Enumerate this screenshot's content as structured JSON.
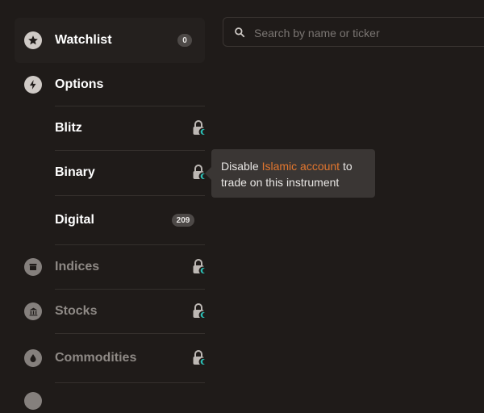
{
  "search": {
    "placeholder": "Search by name or ticker"
  },
  "sidebar": {
    "watchlist": {
      "label": "Watchlist",
      "count": "0"
    },
    "options": {
      "label": "Options"
    },
    "items": [
      {
        "label": "Blitz"
      },
      {
        "label": "Binary"
      },
      {
        "label": "Digital",
        "count": "209"
      },
      {
        "label": "Indices"
      },
      {
        "label": "Stocks"
      },
      {
        "label": "Commodities"
      }
    ]
  },
  "tooltip": {
    "before": "Disable ",
    "link": "Islamic account",
    "after": " to trade on this instrument"
  },
  "colors": {
    "accent": "#e2762e",
    "lock_dot": "#2bbfb5",
    "background": "#1f1b19"
  }
}
